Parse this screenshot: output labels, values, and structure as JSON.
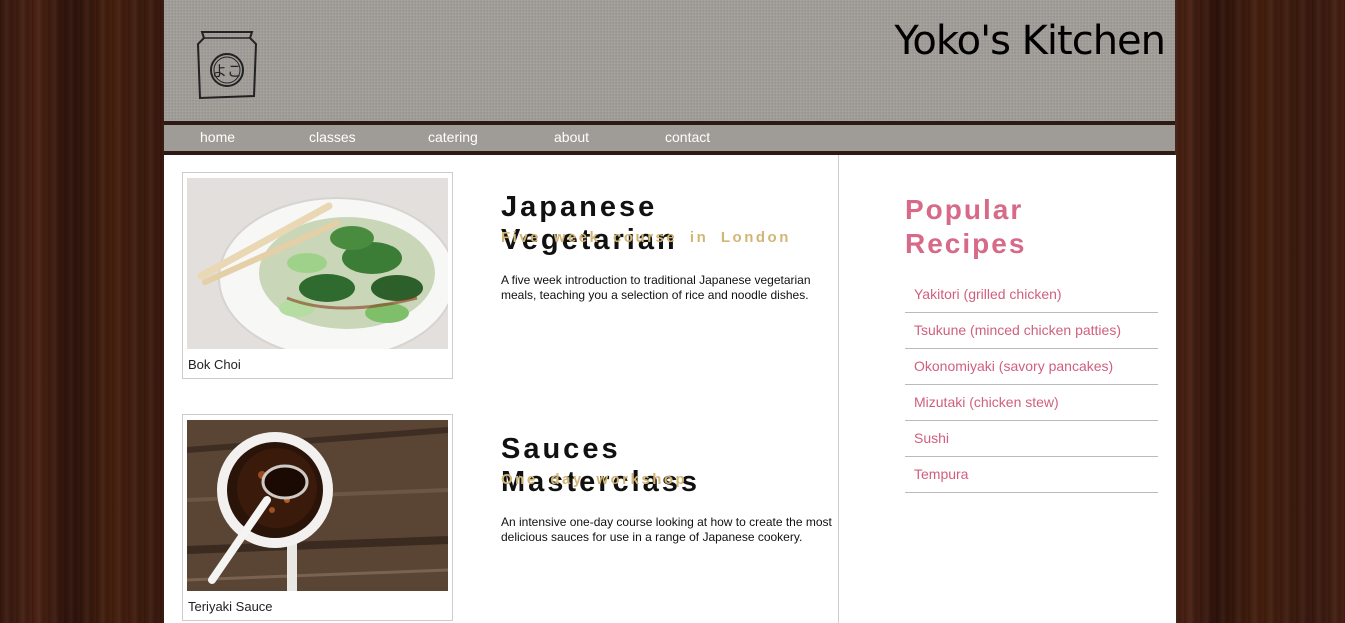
{
  "header": {
    "title": "Yoko's Kitchen"
  },
  "nav": {
    "items": [
      "home",
      "classes",
      "catering",
      "about",
      "contact"
    ]
  },
  "courses": [
    {
      "caption": "Bok Choi",
      "title": "Japanese Vegetarian",
      "subtitle": "Five week course in London",
      "description": "A five week introduction to traditional Japanese vegetarian meals, teaching you a selection of rice and noodle dishes."
    },
    {
      "caption": "Teriyaki Sauce",
      "title": "Sauces Masterclass",
      "subtitle": "One day workshop",
      "description": "An intensive one-day course looking at how to create the most delicious sauces for use in a range of Japanese cookery."
    }
  ],
  "sidebar": {
    "heading_line1": "Popular",
    "heading_line2": "Recipes",
    "recipes": [
      "Yakitori (grilled chicken)",
      "Tsukune (minced chicken patties)",
      "Okonomiyaki (savory pancakes)",
      "Mizutaki (chicken stew)",
      "Sushi",
      "Tempura"
    ]
  },
  "colors": {
    "accent_pink": "#d66a88",
    "subtitle_gold": "#d2b676",
    "wood": "#3a1a10",
    "header_grey": "#9f9b96"
  }
}
